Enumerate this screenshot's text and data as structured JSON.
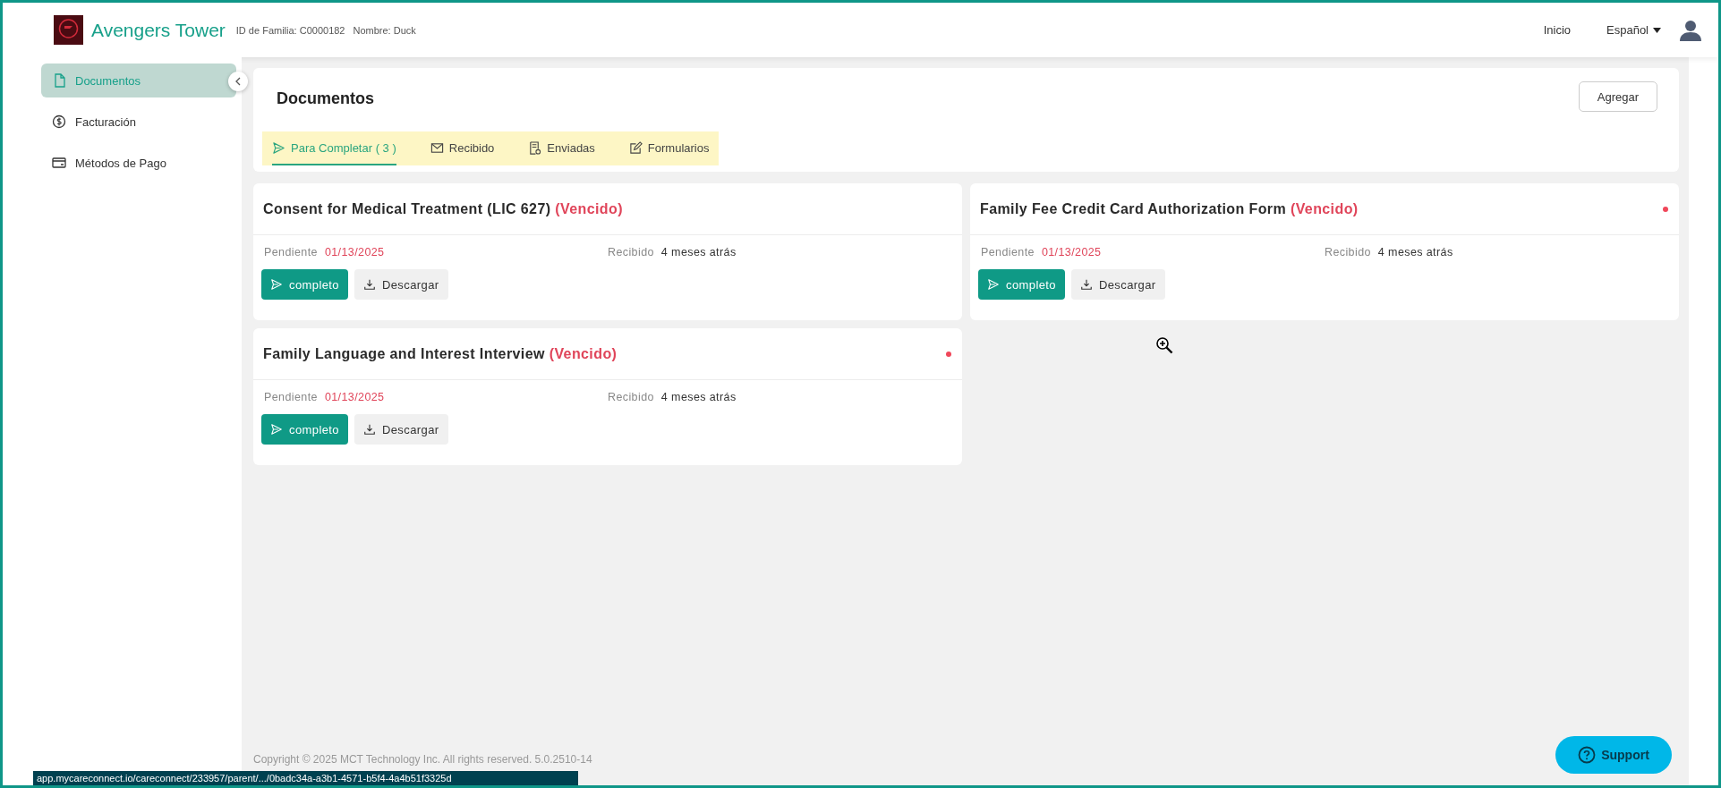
{
  "header": {
    "site_name": "Avengers Tower",
    "family_id": "ID de Familia: C0000182",
    "name": "Nombre: Duck",
    "nav_link": "Inicio",
    "language": "Español"
  },
  "sidebar": {
    "items": [
      {
        "label": "Documentos",
        "selected": true
      },
      {
        "label": "Facturación",
        "selected": false
      },
      {
        "label": "Métodos de Pago",
        "selected": false
      }
    ]
  },
  "panel": {
    "title": "Documentos",
    "add_button": "Agregar",
    "tabs": [
      {
        "label": "Para Completar ( 3 )",
        "selected": true
      },
      {
        "label": "Recibido",
        "selected": false
      },
      {
        "label": "Enviadas",
        "selected": false
      },
      {
        "label": "Formularios",
        "selected": false
      }
    ]
  },
  "documents": [
    {
      "title": "Consent for Medical Treatment (LIC 627)",
      "status": "(Vencido)",
      "unread": false,
      "pending_label": "Pendiente",
      "pending_date": "01/13/2025",
      "received_label": "Recibido",
      "received": "4 meses atrás",
      "complete_button": "completo",
      "download_button": "Descargar"
    },
    {
      "title": "Family Fee Credit Card Authorization Form",
      "status": "(Vencido)",
      "unread": true,
      "pending_label": "Pendiente",
      "pending_date": "01/13/2025",
      "received_label": "Recibido",
      "received": "4 meses atrás",
      "complete_button": "completo",
      "download_button": "Descargar"
    },
    {
      "title": "Family Language and Interest Interview",
      "status": "(Vencido)",
      "unread": true,
      "pending_label": "Pendiente",
      "pending_date": "01/13/2025",
      "received_label": "Recibido",
      "received": "4 meses atrás",
      "complete_button": "completo",
      "download_button": "Descargar"
    }
  ],
  "footer": {
    "copyright": "Copyright © 2025 MCT Technology Inc. All rights reserved. 5.0.2510-14"
  },
  "support_button": "Support",
  "status_url": "app.mycareconnect.io/careconnect/233957/parent/.../0badc34a-a3b1-4571-b5f4-4a4b51f3325d"
}
